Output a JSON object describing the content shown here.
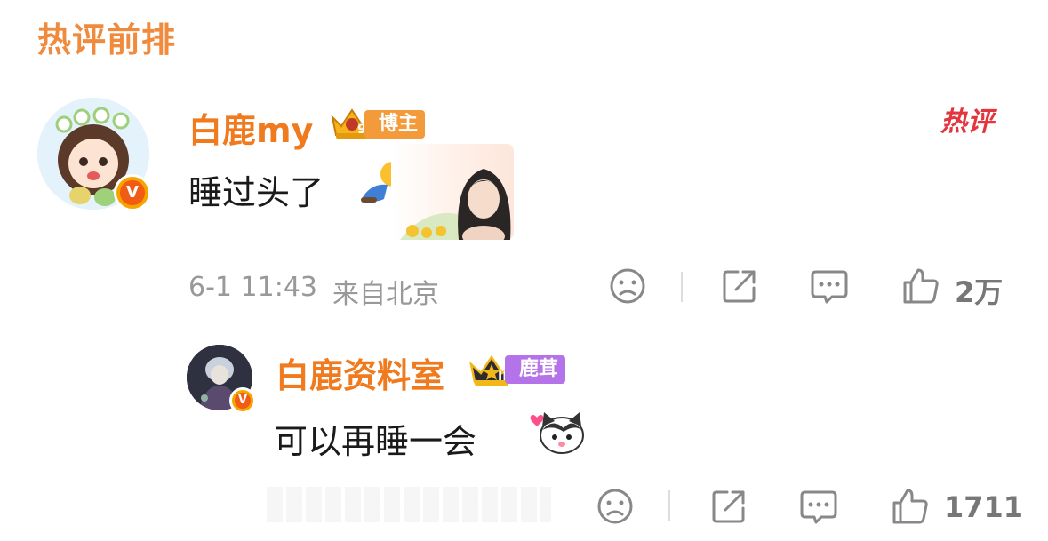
{
  "section_title": "热评前排",
  "comments": [
    {
      "username": "白鹿my",
      "tag": "博主",
      "crown_level": "9",
      "verified": "V",
      "text": "睡过头了",
      "emoji": "sleeping-person-emoji",
      "hot_label": "热评",
      "time": "6-1 11:43",
      "location": "来自北京",
      "likes": "2万",
      "colors": {
        "name": "#f07a1e",
        "tag": "#f39a3b"
      }
    },
    {
      "username": "白鹿资料室",
      "tag": "鹿茸",
      "crown_level": "II",
      "verified": "V",
      "text": "可以再睡一会",
      "emoji": "cat-love-emoji",
      "likes": "1711",
      "colors": {
        "name": "#f07a1e",
        "tag": "#b473e8"
      }
    }
  ],
  "icons": {
    "dislike": "sad-face-icon",
    "share": "share-icon",
    "comment": "comment-icon",
    "like": "thumbs-up-icon"
  }
}
